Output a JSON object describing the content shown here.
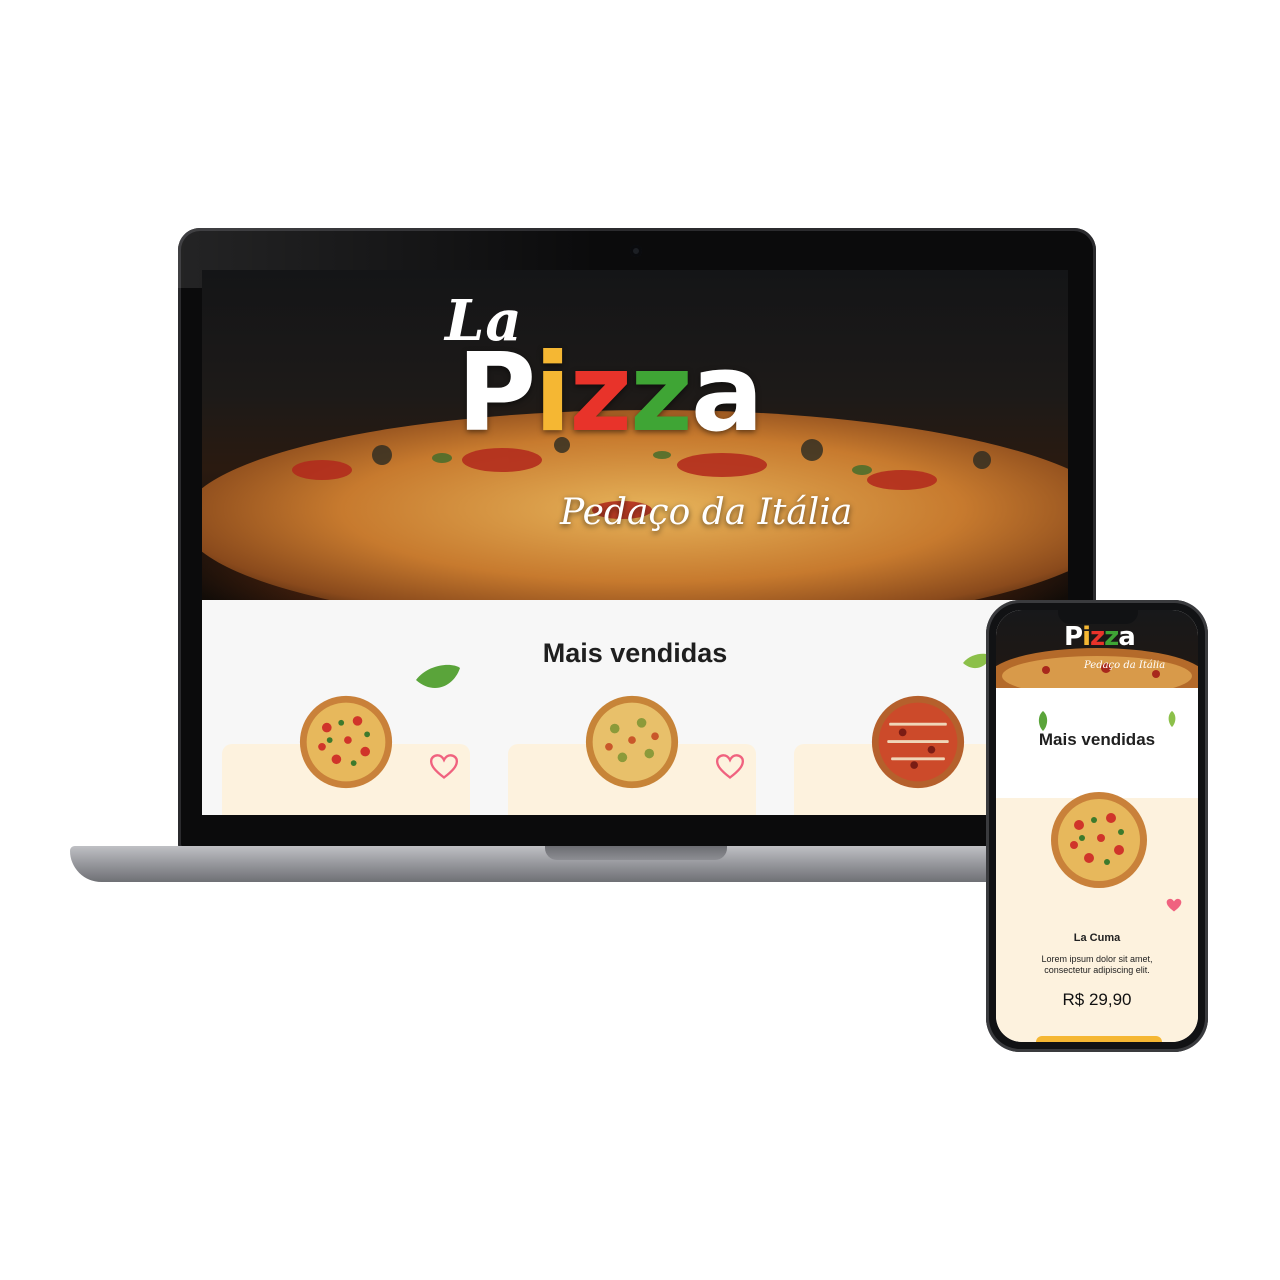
{
  "brand": {
    "logo_prefix": "La",
    "logo_word_letters": [
      "P",
      "i",
      "z",
      "z",
      "a"
    ],
    "logo_letter_colors": [
      "#ffffff",
      "#f5b733",
      "#e8332a",
      "#3fa535",
      "#ffffff"
    ],
    "tagline": "Pedaço da Itália"
  },
  "section": {
    "title": "Mais vendidas"
  },
  "products": [
    {
      "name": "La Cuma",
      "favorite": false
    },
    {
      "favorite": false
    },
    {
      "favorite": false
    }
  ],
  "mobile": {
    "logo_word_letters": [
      "P",
      "i",
      "z",
      "z",
      "a"
    ],
    "tagline": "Pedaço da Itália",
    "section_title": "Mais vendidas",
    "product": {
      "name": "La Cuma",
      "description": "Lorem ipsum dolor sit amet, consectetur adipiscing elit.",
      "price": "R$ 29,90",
      "favorite": true
    }
  },
  "colors": {
    "accent_yellow": "#f5b733",
    "accent_red": "#e8332a",
    "accent_green": "#3fa535",
    "heart": "#f0627f",
    "card_bg": "#fdf2de"
  },
  "icons": [
    "heart-outline-icon",
    "heart-filled-icon",
    "leaf-icon"
  ]
}
